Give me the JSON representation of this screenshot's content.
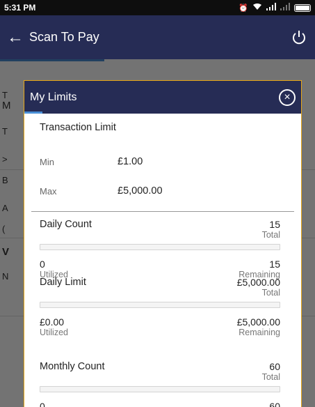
{
  "status_bar": {
    "time": "5:31 PM"
  },
  "app_bar": {
    "title": "Scan To Pay"
  },
  "background": {
    "letters": [
      "T",
      "M",
      "T",
      ">",
      "B",
      "A",
      "(",
      "V",
      "N"
    ]
  },
  "dialog": {
    "title": "My Limits",
    "transaction_limit": {
      "title": "Transaction Limit",
      "min_label": "Min",
      "min_value": "£1.00",
      "max_label": "Max",
      "max_value": "£5,000.00"
    },
    "daily_count": {
      "name": "Daily Count",
      "total": "15",
      "total_label": "Total",
      "utilized": "0",
      "utilized_label": "Utilized",
      "remaining": "15",
      "remaining_label": "Remaining",
      "progress_fraction": 0
    },
    "daily_limit": {
      "name": "Daily Limit",
      "total": "£5,000.00",
      "total_label": "Total",
      "utilized": "£0.00",
      "utilized_label": "Utilized",
      "remaining": "£5,000.00",
      "remaining_label": "Remaining",
      "progress_fraction": 0
    },
    "monthly_count": {
      "name": "Monthly Count",
      "total": "60",
      "total_label": "Total",
      "utilized": "0",
      "remaining": "60",
      "progress_fraction": 0
    }
  },
  "colors": {
    "app_bar": "#262c55",
    "accent": "#4a8fd6",
    "dialog_border": "#e8a817"
  }
}
